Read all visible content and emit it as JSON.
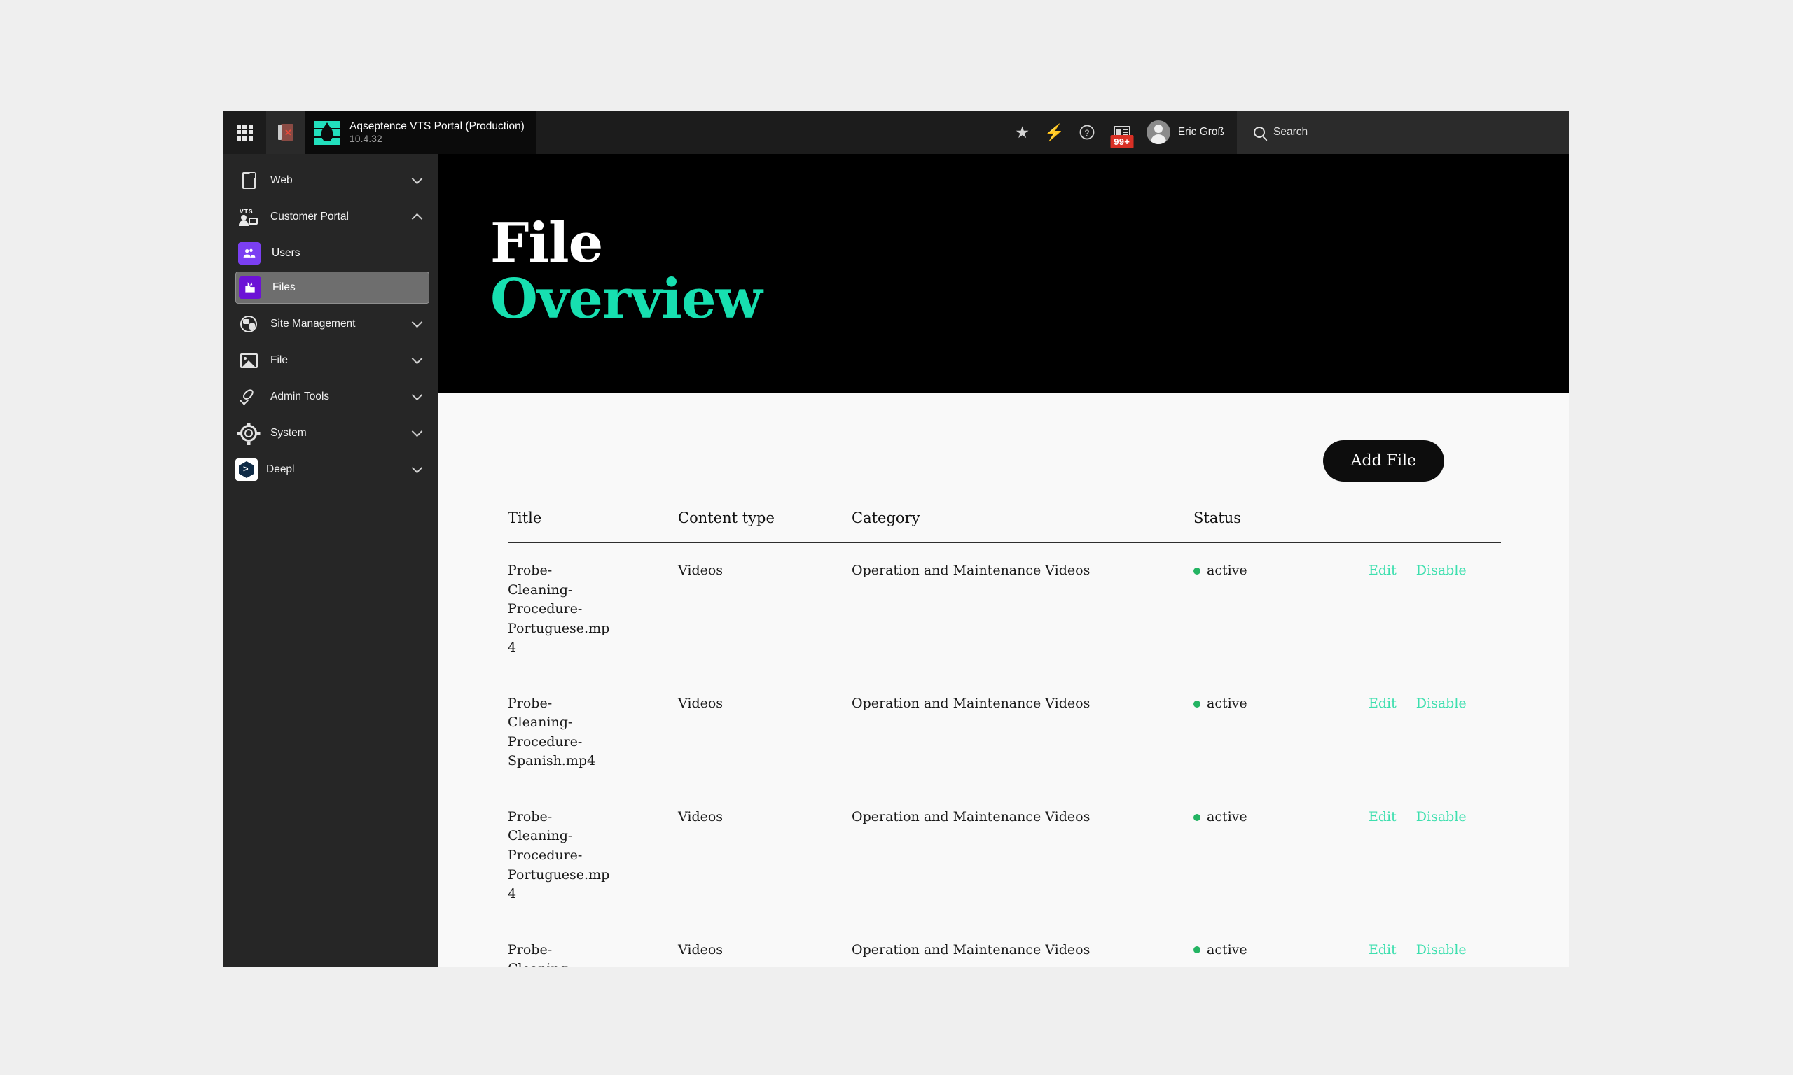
{
  "topbar": {
    "waffle_icon": "grid-apps-icon",
    "notebook_icon": "notebook-icon",
    "brand_title": "Aqseptence VTS Portal (Production)",
    "brand_version": "10.4.32",
    "icons": [
      {
        "name": "star-icon",
        "glyph": "★"
      },
      {
        "name": "bolt-icon",
        "glyph": "⚡"
      },
      {
        "name": "help-icon",
        "glyph": "?"
      }
    ],
    "news_badge": "99+",
    "user_name": "Eric Groß",
    "search_label": "Search"
  },
  "sidebar": {
    "items": [
      {
        "label": "Web",
        "icon": "page-icon",
        "expandable": true,
        "expanded": false
      },
      {
        "label": "Customer Portal",
        "icon": "vts-portal-icon",
        "expandable": true,
        "expanded": true
      },
      {
        "label": "Users",
        "icon": "users-icon",
        "sub": true,
        "active": false
      },
      {
        "label": "Files",
        "icon": "files-icon",
        "sub": true,
        "active": true
      },
      {
        "label": "Site Management",
        "icon": "globe-icon",
        "expandable": true,
        "expanded": false
      },
      {
        "label": "File",
        "icon": "image-icon",
        "expandable": true,
        "expanded": false
      },
      {
        "label": "Admin Tools",
        "icon": "rocket-icon",
        "expandable": true,
        "expanded": false
      },
      {
        "label": "System",
        "icon": "gear-icon",
        "expandable": true,
        "expanded": false
      },
      {
        "label": "Deepl",
        "icon": "deepl-icon",
        "expandable": true,
        "expanded": false
      }
    ]
  },
  "hero": {
    "line1": "File",
    "line2": "Overview"
  },
  "toolbar": {
    "add_file_label": "Add File"
  },
  "table": {
    "columns": [
      "Title",
      "Content type",
      "Category",
      "Status",
      ""
    ],
    "rows": [
      {
        "title": "Probe-Cleaning-Procedure-Portuguese.mp4",
        "content_type": "Videos",
        "category": "Operation and Maintenance Videos",
        "status": "active",
        "edit": "Edit",
        "disable": "Disable"
      },
      {
        "title": "Probe-Cleaning-Procedure-Spanish.mp4",
        "content_type": "Videos",
        "category": "Operation and Maintenance Videos",
        "status": "active",
        "edit": "Edit",
        "disable": "Disable"
      },
      {
        "title": "Probe-Cleaning-Procedure-Portuguese.mp4",
        "content_type": "Videos",
        "category": "Operation and Maintenance Videos",
        "status": "active",
        "edit": "Edit",
        "disable": "Disable"
      },
      {
        "title": "Probe-Cleaning-Procedure-",
        "content_type": "Videos",
        "category": "Operation and Maintenance Videos",
        "status": "active",
        "edit": "Edit",
        "disable": "Disable"
      }
    ]
  },
  "colors": {
    "accent_teal": "#17dfb0",
    "link_teal": "#3ddfae",
    "status_green": "#24b463",
    "badge_red": "#d93025",
    "sidebar_bg": "#262626",
    "hero_bg": "#000000",
    "purple_tile": "#6c12d6"
  }
}
